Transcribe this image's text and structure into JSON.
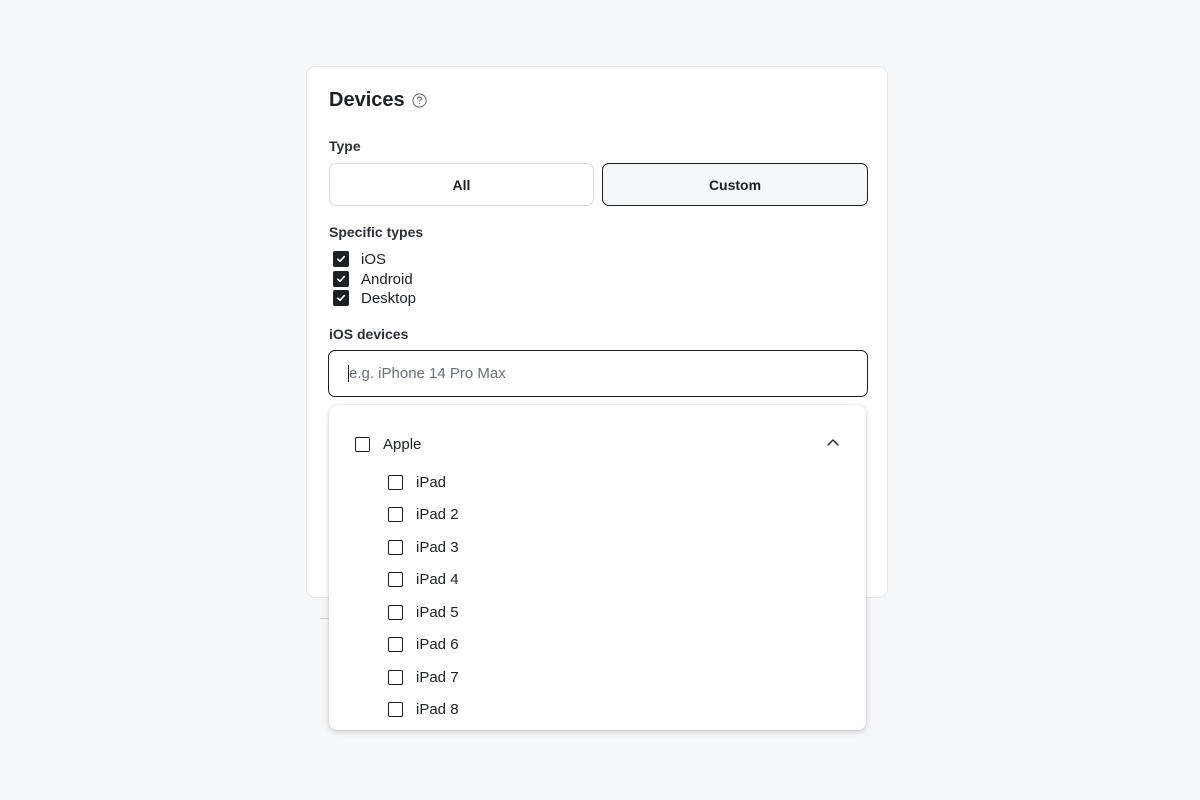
{
  "devices": {
    "title": "Devices",
    "help_icon": "question-circle-icon",
    "type_label": "Type",
    "type_options": {
      "all": "All",
      "custom": "Custom",
      "selected": "Custom"
    },
    "specific_types_label": "Specific types",
    "specific_types": [
      {
        "label": "iOS",
        "checked": true
      },
      {
        "label": "Android",
        "checked": true
      },
      {
        "label": "Desktop",
        "checked": true
      }
    ],
    "ios_devices_label": "iOS devices",
    "ios_search": {
      "placeholder": "e.g. iPhone 14 Pro Max",
      "value": ""
    }
  },
  "dropdown": {
    "group": {
      "label": "Apple",
      "checked": false,
      "expanded": true,
      "chevron_icon": "chevron-up-icon"
    },
    "items": [
      {
        "label": "iPad",
        "checked": false
      },
      {
        "label": "iPad 2",
        "checked": false
      },
      {
        "label": "iPad 3",
        "checked": false
      },
      {
        "label": "iPad 4",
        "checked": false
      },
      {
        "label": "iPad 5",
        "checked": false
      },
      {
        "label": "iPad 6",
        "checked": false
      },
      {
        "label": "iPad 7",
        "checked": false
      },
      {
        "label": "iPad 8",
        "checked": false
      }
    ]
  },
  "colors": {
    "text": "#1d2023",
    "page_background": "#f6f7f9",
    "card_border": "#e3e5e8"
  }
}
